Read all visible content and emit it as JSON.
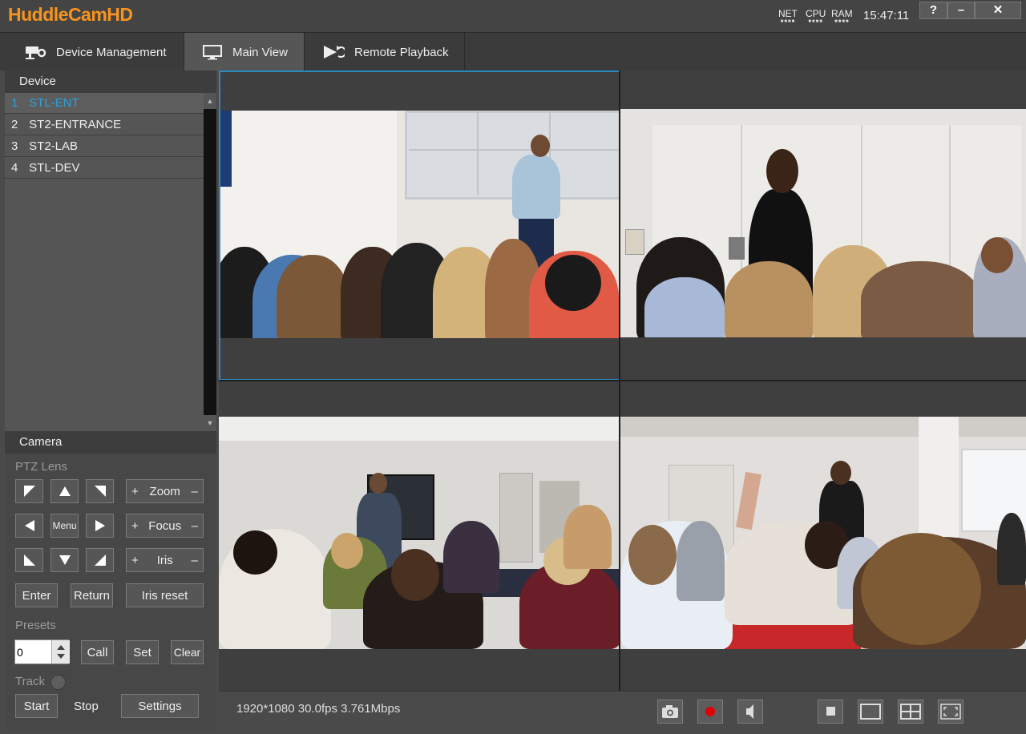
{
  "app": {
    "title": "HuddleCamHD"
  },
  "titlebar": {
    "meters": [
      {
        "label": "NET",
        "dots": "■■■■"
      },
      {
        "label": "CPU",
        "dots": "■■■■"
      },
      {
        "label": "RAM",
        "dots": "■■■■"
      }
    ],
    "clock": "15:47:11",
    "help": "?",
    "minimize": "–",
    "close": "✕"
  },
  "tabs": [
    {
      "label": "Device Management",
      "icon": "cctv-camera-icon"
    },
    {
      "label": "Main View",
      "icon": "monitor-icon",
      "active": true
    },
    {
      "label": "Remote Playback",
      "icon": "playback-icon"
    }
  ],
  "device": {
    "header": "Device",
    "items": [
      {
        "num": "1",
        "name": "STL-ENT",
        "selected": true
      },
      {
        "num": "2",
        "name": "ST2-ENTRANCE"
      },
      {
        "num": "3",
        "name": "ST2-LAB"
      },
      {
        "num": "4",
        "name": "STL-DEV"
      }
    ]
  },
  "camera": {
    "header": "Camera",
    "ptz_label": "PTZ Lens",
    "menu": "Menu",
    "zoom": "Zoom",
    "focus": "Focus",
    "iris": "Iris",
    "plus": "+",
    "minus": "–",
    "enter": "Enter",
    "return": "Return",
    "iris_reset": "Iris reset",
    "presets_label": "Presets",
    "preset_value": "0",
    "call": "Call",
    "set": "Set",
    "clear": "Clear",
    "track_label": "Track",
    "start": "Start",
    "stop": "Stop",
    "settings": "Settings"
  },
  "status": {
    "stream_info": "1920*1080 30.0fps 3.761Mbps"
  },
  "colors": {
    "brand": "#f7941d",
    "selection": "#2a8bc4",
    "device_selected": "#2ea0d8",
    "record": "#e00000"
  }
}
